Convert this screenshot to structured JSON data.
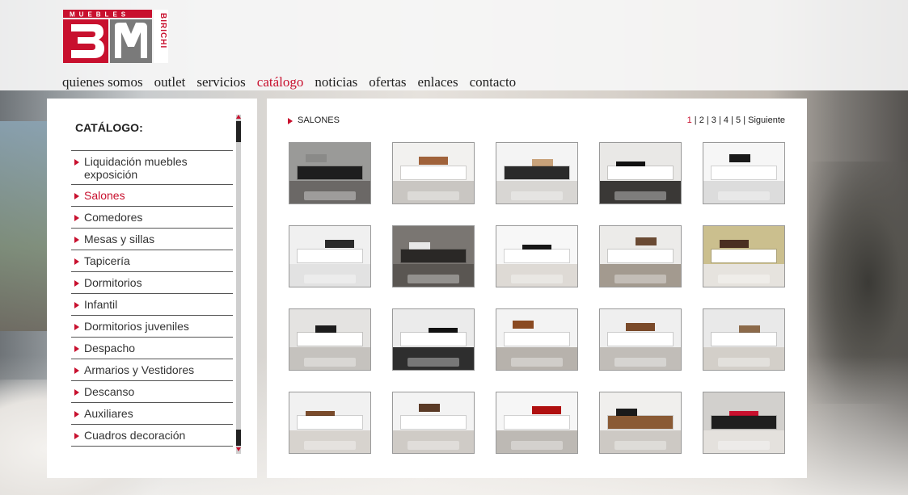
{
  "logo": {
    "top_text": "MUEBLES",
    "side_text": "BIRICHI",
    "letters": "BM"
  },
  "nav": [
    {
      "label": "quienes somos",
      "active": false
    },
    {
      "label": "outlet",
      "active": false
    },
    {
      "label": "servicios",
      "active": false
    },
    {
      "label": "catálogo",
      "active": true
    },
    {
      "label": "noticias",
      "active": false
    },
    {
      "label": "ofertas",
      "active": false
    },
    {
      "label": "enlaces",
      "active": false
    },
    {
      "label": "contacto",
      "active": false
    }
  ],
  "sidebar": {
    "title": "CATÁLOGO:",
    "items": [
      {
        "label": "Liquidación muebles exposición",
        "active": false
      },
      {
        "label": "Salones",
        "active": true
      },
      {
        "label": "Comedores",
        "active": false
      },
      {
        "label": "Mesas y sillas",
        "active": false
      },
      {
        "label": "Tapicería",
        "active": false
      },
      {
        "label": "Dormitorios",
        "active": false
      },
      {
        "label": "Infantil",
        "active": false
      },
      {
        "label": "Dormitorios juveniles",
        "active": false
      },
      {
        "label": "Despacho",
        "active": false
      },
      {
        "label": "Armarios y Vestidores",
        "active": false
      },
      {
        "label": "Descanso",
        "active": false
      },
      {
        "label": "Auxiliares",
        "active": false
      },
      {
        "label": "Cuadros decoración",
        "active": false
      }
    ]
  },
  "main": {
    "section_title": "SALONES",
    "pager": {
      "pages": [
        "1",
        "2",
        "3",
        "4",
        "5"
      ],
      "current": "1",
      "next_label": "Siguiente",
      "separator": " | "
    },
    "thumbnails": [
      {
        "alt": "salon-1",
        "wall": "#9a9a98",
        "floor": "#6b6866",
        "unit": "#1e1e1e",
        "accent": "#8a8a88"
      },
      {
        "alt": "salon-2",
        "wall": "#f2f1ef",
        "floor": "#c9c6c2",
        "unit": "#ffffff",
        "accent": "#a0623a"
      },
      {
        "alt": "salon-3",
        "wall": "#f4f4f4",
        "floor": "#d8d6d3",
        "unit": "#2a2a2a",
        "accent": "#c8a27a"
      },
      {
        "alt": "salon-4",
        "wall": "#e9e8e6",
        "floor": "#3a3836",
        "unit": "#ffffff",
        "accent": "#111111"
      },
      {
        "alt": "salon-5",
        "wall": "#f6f6f6",
        "floor": "#dcdcdc",
        "unit": "#ffffff",
        "accent": "#1a1a1a"
      },
      {
        "alt": "salon-6",
        "wall": "#f0f0f0",
        "floor": "#e2e2e2",
        "unit": "#ffffff",
        "accent": "#2b2b2b"
      },
      {
        "alt": "salon-7",
        "wall": "#7a7672",
        "floor": "#5a5652",
        "unit": "#2a2826",
        "accent": "#e8e8e8"
      },
      {
        "alt": "salon-8",
        "wall": "#f7f7f7",
        "floor": "#dedad5",
        "unit": "#ffffff",
        "accent": "#161616"
      },
      {
        "alt": "salon-9",
        "wall": "#ecebe9",
        "floor": "#a39a8f",
        "unit": "#ffffff",
        "accent": "#6a4a33"
      },
      {
        "alt": "salon-10",
        "wall": "#cbbf8e",
        "floor": "#e6e3de",
        "unit": "#ffffff",
        "accent": "#4a2e22"
      },
      {
        "alt": "salon-11",
        "wall": "#e4e3e1",
        "floor": "#c5c2be",
        "unit": "#ffffff",
        "accent": "#1c1c1c"
      },
      {
        "alt": "salon-12",
        "wall": "#ebebeb",
        "floor": "#2e2e2e",
        "unit": "#ffffff",
        "accent": "#111111"
      },
      {
        "alt": "salon-13",
        "wall": "#f3f3f3",
        "floor": "#b7b2ac",
        "unit": "#ffffff",
        "accent": "#8a4a22"
      },
      {
        "alt": "salon-14",
        "wall": "#efefef",
        "floor": "#c1bdb8",
        "unit": "#ffffff",
        "accent": "#7a4a2a"
      },
      {
        "alt": "salon-15",
        "wall": "#e9e9e9",
        "floor": "#d3cfc9",
        "unit": "#ffffff",
        "accent": "#8c6a4a"
      },
      {
        "alt": "salon-16",
        "wall": "#f1f1f1",
        "floor": "#d7d3ce",
        "unit": "#ffffff",
        "accent": "#7a4b2b"
      },
      {
        "alt": "salon-17",
        "wall": "#f3f3f3",
        "floor": "#cfcbc6",
        "unit": "#ffffff",
        "accent": "#5a3a26"
      },
      {
        "alt": "salon-18",
        "wall": "#f6f6f6",
        "floor": "#bdb9b4",
        "unit": "#ffffff",
        "accent": "#b01010"
      },
      {
        "alt": "salon-19",
        "wall": "#f0efed",
        "floor": "#cdc9c4",
        "unit": "#8a5a34",
        "accent": "#1a1a1a"
      },
      {
        "alt": "salon-20",
        "wall": "#d2d0cd",
        "floor": "#e4e1dd",
        "unit": "#1e1e1e",
        "accent": "#c8102e"
      }
    ]
  },
  "colors": {
    "accent": "#c8102e",
    "text": "#222222",
    "panel": "#ffffff",
    "header_bg": "#f6f6f6"
  }
}
